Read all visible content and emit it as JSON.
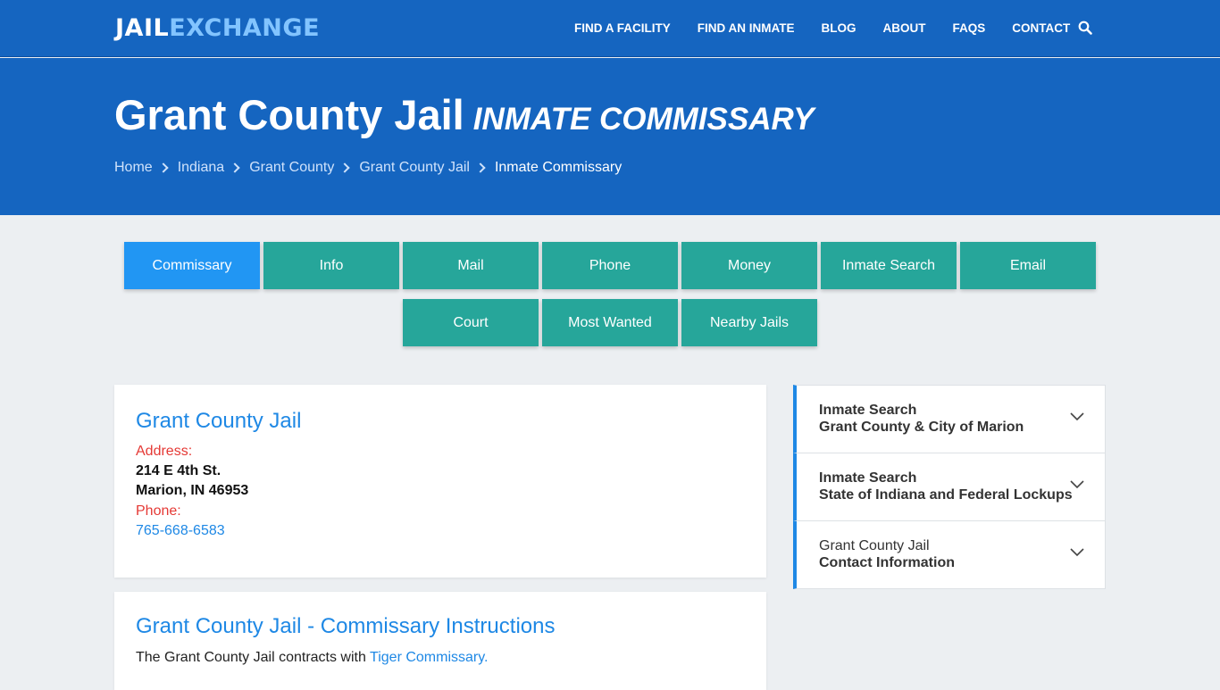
{
  "brand": {
    "part1": "JAIL",
    "part2": "EXCHANGE"
  },
  "nav": {
    "items": [
      "FIND A FACILITY",
      "FIND AN INMATE",
      "BLOG",
      "ABOUT",
      "FAQs",
      "CONTACT"
    ],
    "search_icon": "search-icon"
  },
  "hero": {
    "title": "Grant County Jail",
    "subtitle": "Inmate Commissary",
    "breadcrumb": [
      "Home",
      "Indiana",
      "Grant County",
      "Grant County Jail",
      "Inmate Commissary"
    ]
  },
  "tabs": {
    "row1": [
      "Commissary",
      "Info",
      "Mail",
      "Phone",
      "Money",
      "Inmate Search",
      "Email"
    ],
    "row2": [
      "Court",
      "Most Wanted",
      "Nearby Jails"
    ],
    "active": "Commissary"
  },
  "facility": {
    "name": "Grant County Jail",
    "address_label": "Address:",
    "address_line1": "214 E 4th St.",
    "address_line2": "Marion, IN 46953",
    "phone_label": "Phone:",
    "phone": "765-668-6583"
  },
  "instructions": {
    "title": "Grant County Jail - Commissary Instructions",
    "text": "The Grant County Jail contracts with",
    "link": "Tiger Commissary."
  },
  "sidebar": [
    {
      "line1": "Inmate Search",
      "line2": "Grant County & City of Marion",
      "line1_bold": true
    },
    {
      "line1": "Inmate Search",
      "line2": "State of Indiana and Federal Lockups",
      "line1_bold": true
    },
    {
      "line1": "Grant County Jail",
      "line2": "Contact Information",
      "line1_bold": false
    }
  ],
  "colors": {
    "header_blue": "#1565c0",
    "tab_teal": "#26a69a",
    "tab_active": "#2196f3",
    "link_blue": "#1e88e5",
    "label_red": "#e53935"
  }
}
